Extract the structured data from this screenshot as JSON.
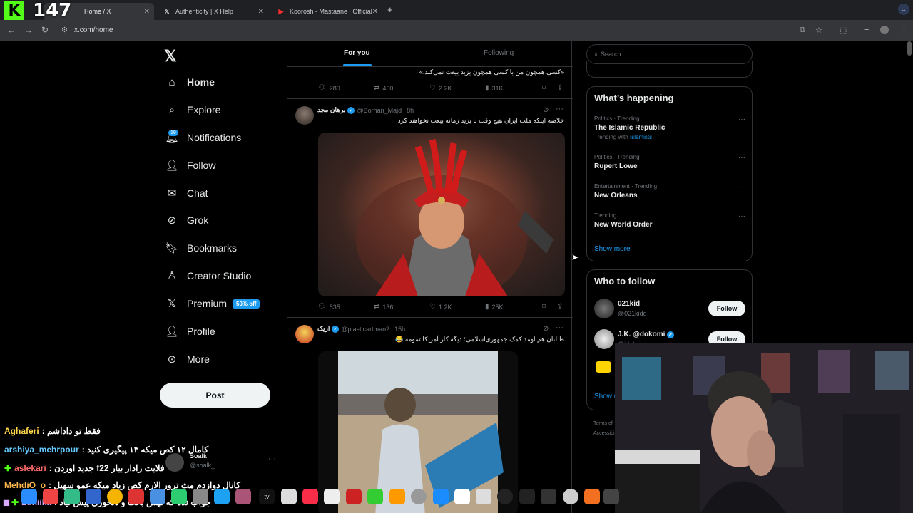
{
  "browser": {
    "tabs": [
      {
        "title": "Home / X",
        "icon": "x-icon",
        "active": true
      },
      {
        "title": "Authenticity | X Help",
        "icon": "x-icon",
        "active": false
      },
      {
        "title": "Koorosh - Mastaane | Official",
        "icon": "youtube-icon",
        "active": false
      }
    ],
    "url": "x.com/home"
  },
  "stream_overlay": {
    "viewer_count": "147",
    "logo_letter": "K",
    "chat": [
      {
        "user": "Aghaferi",
        "user_color": "#ffd84d",
        "message": ": فقط تو داداشم",
        "badge": ""
      },
      {
        "user": "arshiya_mehrpour",
        "user_color": "#66c9ff",
        "message": ": کامال ۱۲ کص میکه ۱۴ پیگیری کنید",
        "badge": ""
      },
      {
        "user": "aslekari",
        "user_color": "#ff6b6b",
        "message": ": جدید اوردن f22 فلایت رادار بیار",
        "badge": "plus"
      },
      {
        "user": "MehdiO_o",
        "user_color": "#ffb84d",
        "message": ": کانال دوازدم مث ترور الارم کص زیاد میکه عمو سهیل",
        "badge": ""
      },
      {
        "user": "Luniika",
        "user_color": "#d9a8ff",
        "message": ": جواب نده که تهش بحث و دلخوری پیش نیاد",
        "badge": "plus2"
      }
    ]
  },
  "sidebar": {
    "items": [
      {
        "label": "Home",
        "icon": "home-icon",
        "bold": true
      },
      {
        "label": "Explore",
        "icon": "search-icon"
      },
      {
        "label": "Notifications",
        "icon": "bell-icon",
        "badge": "19"
      },
      {
        "label": "Follow",
        "icon": "person-plus-icon"
      },
      {
        "label": "Chat",
        "icon": "mail-icon"
      },
      {
        "label": "Grok",
        "icon": "grok-icon"
      },
      {
        "label": "Bookmarks",
        "icon": "bookmark-icon"
      },
      {
        "label": "Creator Studio",
        "icon": "creator-icon"
      },
      {
        "label": "Premium",
        "icon": "x-icon",
        "badge": "50% off"
      },
      {
        "label": "Profile",
        "icon": "person-icon"
      },
      {
        "label": "More",
        "icon": "more-icon"
      }
    ],
    "post_label": "Post",
    "account": {
      "name": "Soalk",
      "handle": "@soalk_"
    }
  },
  "timeline": {
    "tabs": [
      "For you",
      "Following"
    ],
    "tweet0": {
      "text": "«کسی همچون من با کسی همچون یزید بیعت نمی‌کند.»",
      "replies": "280",
      "reposts": "460",
      "likes": "2.2K",
      "views": "31K"
    },
    "tweet1": {
      "name": "برهان مجد",
      "handle": "@Borhan_Majd",
      "time": "8h",
      "text": "خلاصه اینکه ملت ایران هیچ وقت با یزید زمانه بیعت نخواهند کرد",
      "replies": "535",
      "reposts": "136",
      "likes": "1.2K",
      "views": "25K"
    },
    "tweet2": {
      "name": "اریک",
      "handle": "@plasticartman2",
      "time": "15h",
      "text": "طالبان هم اومد کمک جمهوری‌اسلامی؛ دیگه کار آمریکا تمومه 😂"
    }
  },
  "right": {
    "search_placeholder": "Search",
    "whats_happening_title": "What’s happening",
    "trends": [
      {
        "meta": "Politics · Trending",
        "name": "The Islamic Republic",
        "extra_prefix": "Trending with",
        "extra_link": "Islamists"
      },
      {
        "meta": "Politics · Trending",
        "name": "Rupert Lowe"
      },
      {
        "meta": "Entertainment · Trending",
        "name": "New Orleans"
      },
      {
        "meta": "Trending",
        "name": "New World Order"
      }
    ],
    "show_more": "Show more",
    "who_to_follow_title": "Who to follow",
    "follow_suggestions": [
      {
        "name": "021kid",
        "handle": "@021kidd",
        "button": "Follow"
      },
      {
        "name": "J.K. @dokomi",
        "handle": "@jdokomi",
        "button": "Follow"
      }
    ],
    "show_more_2": "Show m",
    "footer": [
      "Terms of",
      "Accessibi"
    ]
  }
}
